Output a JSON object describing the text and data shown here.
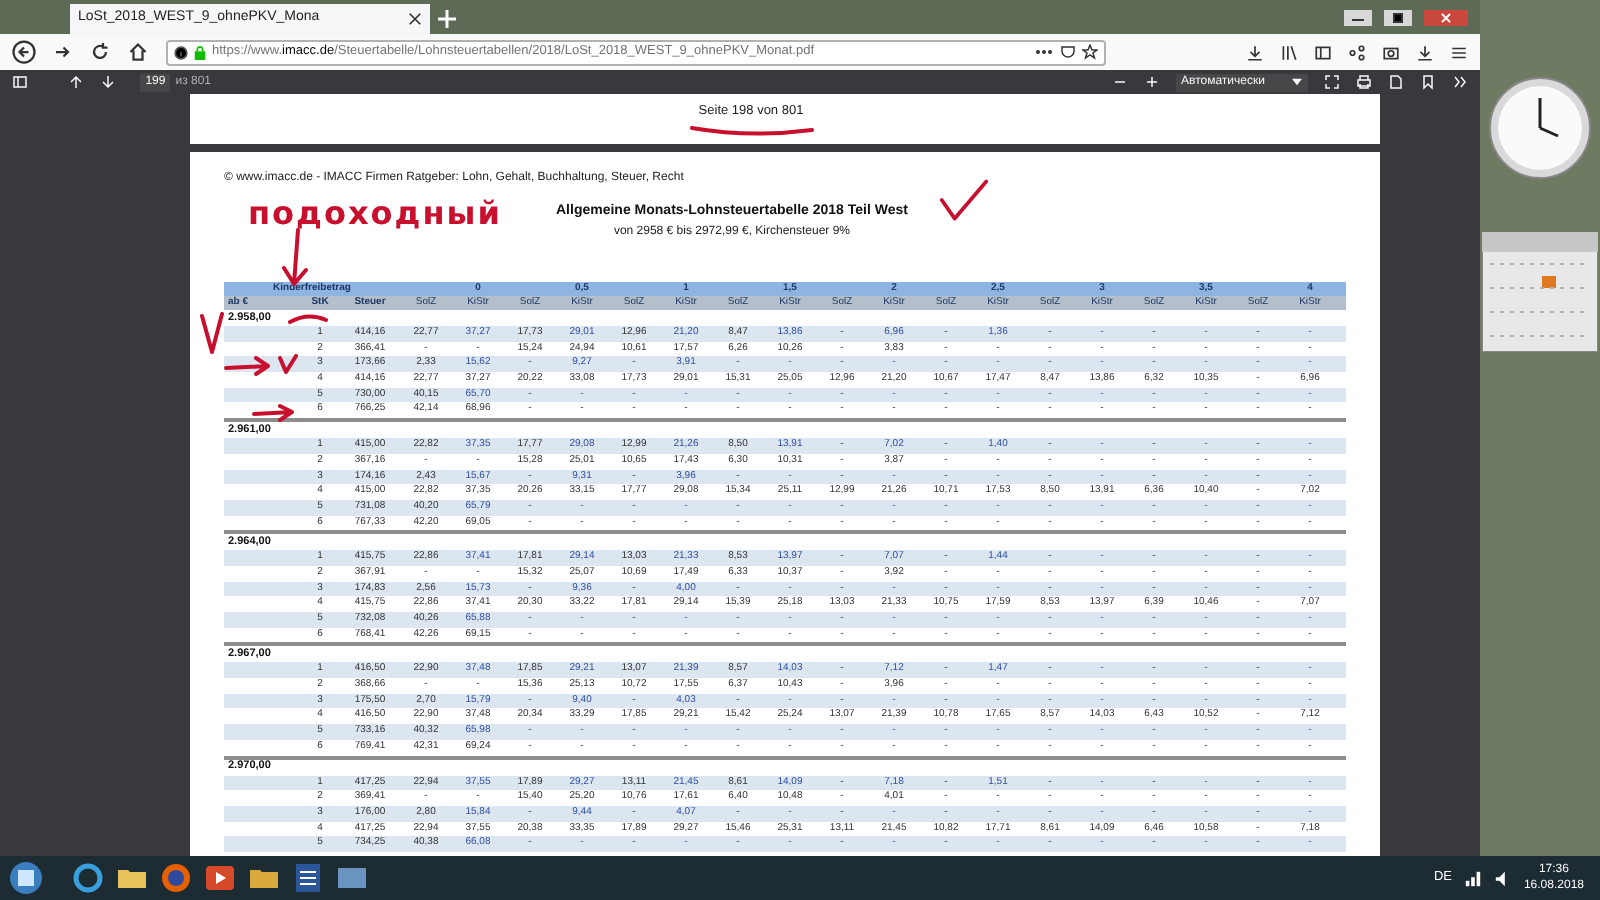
{
  "browser": {
    "tab_title": "LoSt_2018_WEST_9_ohnePKV_Mona",
    "url_prefix": "https://www.",
    "url_domain": "imacc.de",
    "url_path": "/Steuertabelle/Lohnsteuertabellen/2018/LoSt_2018_WEST_9_ohnePKV_Monat.pdf",
    "page_number": "199",
    "page_count": "из 801",
    "zoom": "Автоматически"
  },
  "pdf": {
    "page_footer": "Seite 198 von 801",
    "copyright": "© www.imacc.de - IMACC Firmen Ratgeber: Lohn, Gehalt, Buchhaltung, Steuer, Recht",
    "handwritten_note": "подоходный",
    "title": "Allgemeine Monats-Lohnsteuertabelle 2018 Teil West",
    "subtitle": "von 2958 € bis 2972,99 €, Kirchensteuer 9%",
    "table": {
      "group_label": "Kinderfreibetrag",
      "groups": [
        "0",
        "0,5",
        "1",
        "1,5",
        "2",
        "2,5",
        "3",
        "3,5",
        "4"
      ],
      "columns": [
        "ab €",
        "StK",
        "Steuer",
        "SolZ",
        "KiStr",
        "SolZ",
        "KiStr",
        "SolZ",
        "KiStr",
        "SolZ",
        "KiStr",
        "SolZ",
        "KiStr",
        "SolZ",
        "KiStr",
        "SolZ",
        "KiStr",
        "SolZ",
        "KiStr",
        "SolZ",
        "KiStr"
      ],
      "blocks": [
        {
          "from": "2.958,00",
          "rows": [
            {
              "stk": "1",
              "values": [
                "414,16",
                "22,77",
                "37,27",
                "17,73",
                "29,01",
                "12,96",
                "21,20",
                "8,47",
                "13,86",
                "-",
                "6,96",
                "-",
                "1,36",
                "-",
                "-",
                "-",
                "-",
                "-",
                "-"
              ]
            },
            {
              "stk": "2",
              "values": [
                "366,41",
                "-",
                "-",
                "15,24",
                "24,94",
                "10,61",
                "17,57",
                "6,26",
                "10,26",
                "-",
                "3,83",
                "-",
                "-",
                "-",
                "-",
                "-",
                "-",
                "-",
                "-"
              ]
            },
            {
              "stk": "3",
              "values": [
                "173,66",
                "2,33",
                "15,62",
                "-",
                "9,27",
                "-",
                "3,91",
                "-",
                "-",
                "-",
                "-",
                "-",
                "-",
                "-",
                "-",
                "-",
                "-",
                "-",
                "-"
              ]
            },
            {
              "stk": "4",
              "values": [
                "414,16",
                "22,77",
                "37,27",
                "20,22",
                "33,08",
                "17,73",
                "29,01",
                "15,31",
                "25,05",
                "12,96",
                "21,20",
                "10,67",
                "17,47",
                "8,47",
                "13,86",
                "6,32",
                "10,35",
                "-",
                "6,96"
              ]
            },
            {
              "stk": "5",
              "values": [
                "730,00",
                "40,15",
                "65,70",
                "-",
                "-",
                "-",
                "-",
                "-",
                "-",
                "-",
                "-",
                "-",
                "-",
                "-",
                "-",
                "-",
                "-",
                "-",
                "-"
              ]
            },
            {
              "stk": "6",
              "values": [
                "766,25",
                "42,14",
                "68,96",
                "-",
                "-",
                "-",
                "-",
                "-",
                "-",
                "-",
                "-",
                "-",
                "-",
                "-",
                "-",
                "-",
                "-",
                "-",
                "-"
              ]
            }
          ]
        },
        {
          "from": "2.961,00",
          "rows": [
            {
              "stk": "1",
              "values": [
                "415,00",
                "22,82",
                "37,35",
                "17,77",
                "29,08",
                "12,99",
                "21,26",
                "8,50",
                "13,91",
                "-",
                "7,02",
                "-",
                "1,40",
                "-",
                "-",
                "-",
                "-",
                "-",
                "-"
              ]
            },
            {
              "stk": "2",
              "values": [
                "367,16",
                "-",
                "-",
                "15,28",
                "25,01",
                "10,65",
                "17,43",
                "6,30",
                "10,31",
                "-",
                "3,87",
                "-",
                "-",
                "-",
                "-",
                "-",
                "-",
                "-",
                "-"
              ]
            },
            {
              "stk": "3",
              "values": [
                "174,16",
                "2,43",
                "15,67",
                "-",
                "9,31",
                "-",
                "3,96",
                "-",
                "-",
                "-",
                "-",
                "-",
                "-",
                "-",
                "-",
                "-",
                "-",
                "-",
                "-"
              ]
            },
            {
              "stk": "4",
              "values": [
                "415,00",
                "22,82",
                "37,35",
                "20,26",
                "33,15",
                "17,77",
                "29,08",
                "15,34",
                "25,11",
                "12,99",
                "21,26",
                "10,71",
                "17,53",
                "8,50",
                "13,91",
                "6,36",
                "10,40",
                "-",
                "7,02"
              ]
            },
            {
              "stk": "5",
              "values": [
                "731,08",
                "40,20",
                "65,79",
                "-",
                "-",
                "-",
                "-",
                "-",
                "-",
                "-",
                "-",
                "-",
                "-",
                "-",
                "-",
                "-",
                "-",
                "-",
                "-"
              ]
            },
            {
              "stk": "6",
              "values": [
                "767,33",
                "42,20",
                "69,05",
                "-",
                "-",
                "-",
                "-",
                "-",
                "-",
                "-",
                "-",
                "-",
                "-",
                "-",
                "-",
                "-",
                "-",
                "-",
                "-"
              ]
            }
          ]
        },
        {
          "from": "2.964,00",
          "rows": [
            {
              "stk": "1",
              "values": [
                "415,75",
                "22,86",
                "37,41",
                "17,81",
                "29,14",
                "13,03",
                "21,33",
                "8,53",
                "13,97",
                "-",
                "7,07",
                "-",
                "1,44",
                "-",
                "-",
                "-",
                "-",
                "-",
                "-"
              ]
            },
            {
              "stk": "2",
              "values": [
                "367,91",
                "-",
                "-",
                "15,32",
                "25,07",
                "10,69",
                "17,49",
                "6,33",
                "10,37",
                "-",
                "3,92",
                "-",
                "-",
                "-",
                "-",
                "-",
                "-",
                "-",
                "-"
              ]
            },
            {
              "stk": "3",
              "values": [
                "174,83",
                "2,56",
                "15,73",
                "-",
                "9,36",
                "-",
                "4,00",
                "-",
                "-",
                "-",
                "-",
                "-",
                "-",
                "-",
                "-",
                "-",
                "-",
                "-",
                "-"
              ]
            },
            {
              "stk": "4",
              "values": [
                "415,75",
                "22,86",
                "37,41",
                "20,30",
                "33,22",
                "17,81",
                "29,14",
                "15,39",
                "25,18",
                "13,03",
                "21,33",
                "10,75",
                "17,59",
                "8,53",
                "13,97",
                "6,39",
                "10,46",
                "-",
                "7,07"
              ]
            },
            {
              "stk": "5",
              "values": [
                "732,08",
                "40,26",
                "65,88",
                "-",
                "-",
                "-",
                "-",
                "-",
                "-",
                "-",
                "-",
                "-",
                "-",
                "-",
                "-",
                "-",
                "-",
                "-",
                "-"
              ]
            },
            {
              "stk": "6",
              "values": [
                "768,41",
                "42,26",
                "69,15",
                "-",
                "-",
                "-",
                "-",
                "-",
                "-",
                "-",
                "-",
                "-",
                "-",
                "-",
                "-",
                "-",
                "-",
                "-",
                "-"
              ]
            }
          ]
        },
        {
          "from": "2.967,00",
          "rows": [
            {
              "stk": "1",
              "values": [
                "416,50",
                "22,90",
                "37,48",
                "17,85",
                "29,21",
                "13,07",
                "21,39",
                "8,57",
                "14,03",
                "-",
                "7,12",
                "-",
                "1,47",
                "-",
                "-",
                "-",
                "-",
                "-",
                "-"
              ]
            },
            {
              "stk": "2",
              "values": [
                "368,66",
                "-",
                "-",
                "15,36",
                "25,13",
                "10,72",
                "17,55",
                "6,37",
                "10,43",
                "-",
                "3,96",
                "-",
                "-",
                "-",
                "-",
                "-",
                "-",
                "-",
                "-"
              ]
            },
            {
              "stk": "3",
              "values": [
                "175,50",
                "2,70",
                "15,79",
                "-",
                "9,40",
                "-",
                "4,03",
                "-",
                "-",
                "-",
                "-",
                "-",
                "-",
                "-",
                "-",
                "-",
                "-",
                "-",
                "-"
              ]
            },
            {
              "stk": "4",
              "values": [
                "416,50",
                "22,90",
                "37,48",
                "20,34",
                "33,29",
                "17,85",
                "29,21",
                "15,42",
                "25,24",
                "13,07",
                "21,39",
                "10,78",
                "17,65",
                "8,57",
                "14,03",
                "6,43",
                "10,52",
                "-",
                "7,12"
              ]
            },
            {
              "stk": "5",
              "values": [
                "733,16",
                "40,32",
                "65,98",
                "-",
                "-",
                "-",
                "-",
                "-",
                "-",
                "-",
                "-",
                "-",
                "-",
                "-",
                "-",
                "-",
                "-",
                "-",
                "-"
              ]
            },
            {
              "stk": "6",
              "values": [
                "769,41",
                "42,31",
                "69,24",
                "-",
                "-",
                "-",
                "-",
                "-",
                "-",
                "-",
                "-",
                "-",
                "-",
                "-",
                "-",
                "-",
                "-",
                "-",
                "-"
              ]
            }
          ]
        },
        {
          "from": "2.970,00",
          "rows": [
            {
              "stk": "1",
              "values": [
                "417,25",
                "22,94",
                "37,55",
                "17,89",
                "29,27",
                "13,11",
                "21,45",
                "8,61",
                "14,09",
                "-",
                "7,18",
                "-",
                "1,51",
                "-",
                "-",
                "-",
                "-",
                "-",
                "-"
              ]
            },
            {
              "stk": "2",
              "values": [
                "369,41",
                "-",
                "-",
                "15,40",
                "25,20",
                "10,76",
                "17,61",
                "6,40",
                "10,48",
                "-",
                "4,01",
                "-",
                "-",
                "-",
                "-",
                "-",
                "-",
                "-",
                "-"
              ]
            },
            {
              "stk": "3",
              "values": [
                "176,00",
                "2,80",
                "15,84",
                "-",
                "9,44",
                "-",
                "4,07",
                "-",
                "-",
                "-",
                "-",
                "-",
                "-",
                "-",
                "-",
                "-",
                "-",
                "-",
                "-"
              ]
            },
            {
              "stk": "4",
              "values": [
                "417,25",
                "22,94",
                "37,55",
                "20,38",
                "33,35",
                "17,89",
                "29,27",
                "15,46",
                "25,31",
                "13,11",
                "21,45",
                "10,82",
                "17,71",
                "8,61",
                "14,09",
                "6,46",
                "10,58",
                "-",
                "7,18"
              ]
            },
            {
              "stk": "5",
              "values": [
                "734,25",
                "40,38",
                "66,08",
                "-",
                "-",
                "-",
                "-",
                "-",
                "-",
                "-",
                "-",
                "-",
                "-",
                "-",
                "-",
                "-",
                "-",
                "-",
                "-"
              ]
            }
          ]
        }
      ]
    }
  },
  "taskbar": {
    "language": "DE",
    "time": "17:36",
    "date": "16.08.2018"
  }
}
